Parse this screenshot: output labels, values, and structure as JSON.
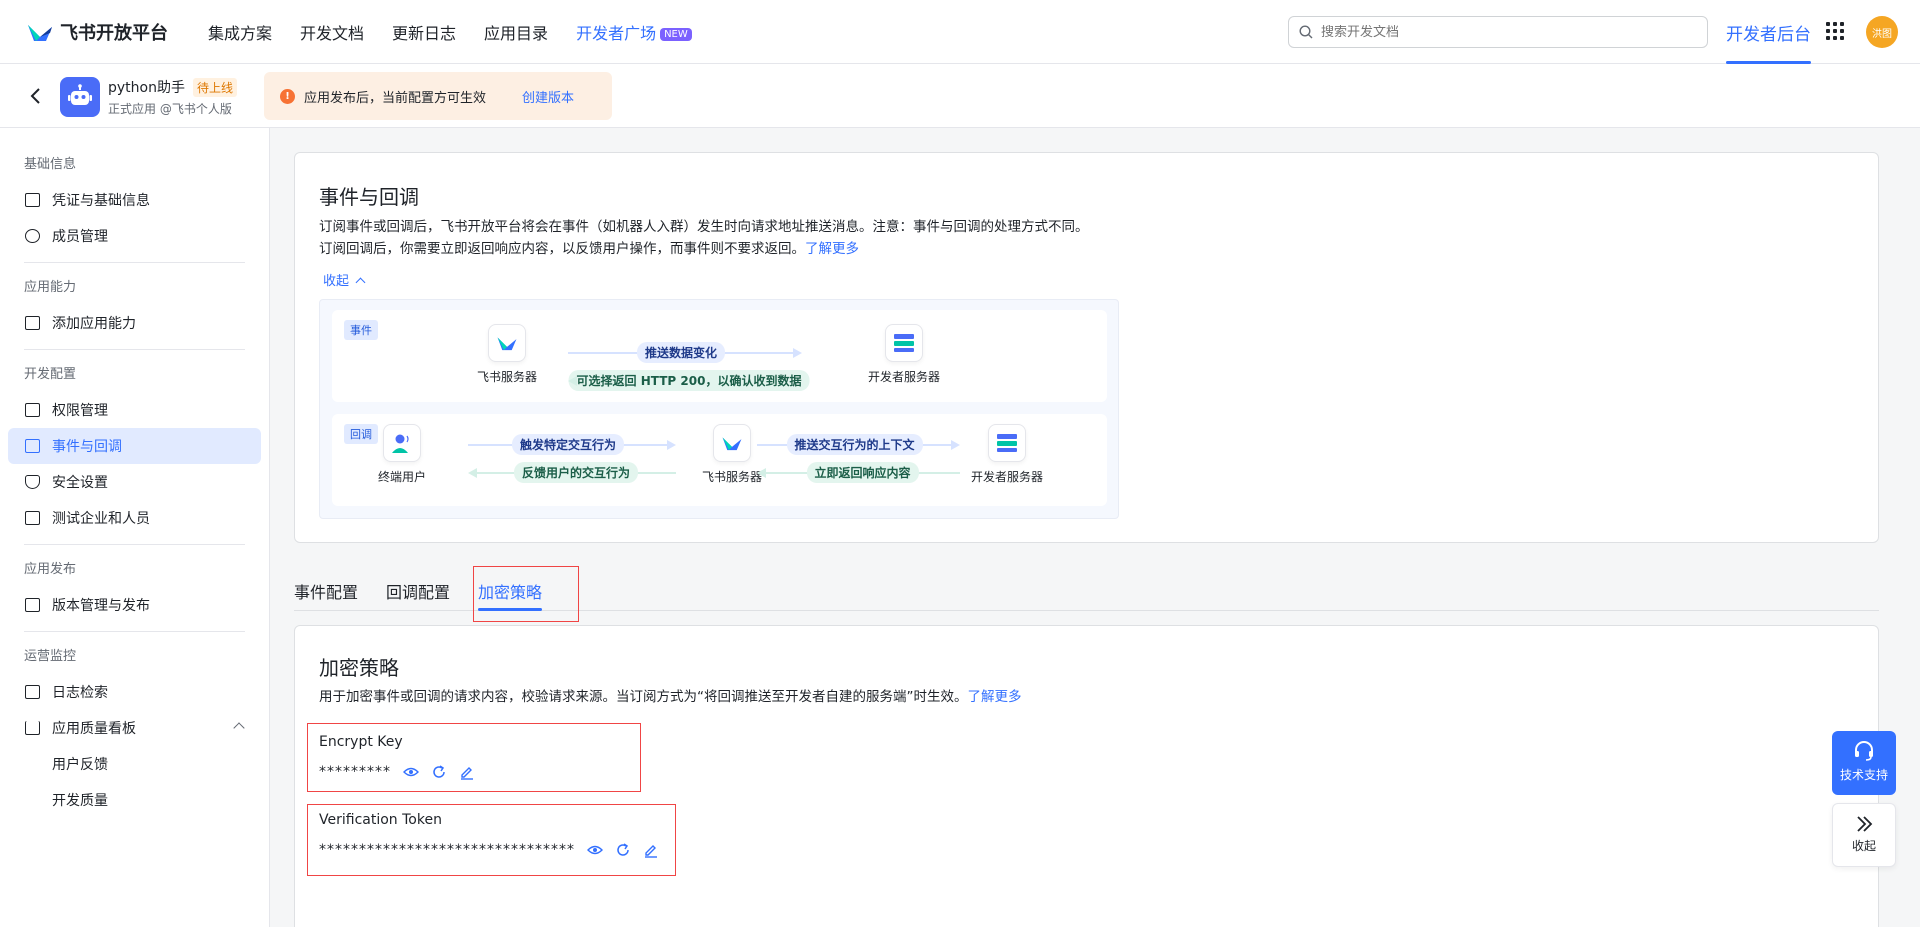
{
  "topnav": {
    "logo": "飞书开放平台",
    "items": [
      "集成方案",
      "开发文档",
      "更新日志",
      "应用目录"
    ],
    "highlight_item": "开发者广场",
    "new_badge": "NEW",
    "search_placeholder": "搜索开发文档",
    "dev_console": "开发者后台",
    "avatar": "洪图"
  },
  "appbar": {
    "app_name": "python助手",
    "status_badge": "待上线",
    "app_sub": "正式应用 @飞书个人版",
    "notice_text": "应用发布后，当前配置方可生效",
    "notice_link": "创建版本"
  },
  "sidebar": {
    "groups": [
      {
        "title": "基础信息",
        "items": [
          "凭证与基础信息",
          "成员管理"
        ]
      },
      {
        "title": "应用能力",
        "items": [
          "添加应用能力"
        ]
      },
      {
        "title": "开发配置",
        "items": [
          "权限管理",
          "事件与回调",
          "安全设置",
          "测试企业和人员"
        ]
      },
      {
        "title": "应用发布",
        "items": [
          "版本管理与发布"
        ]
      },
      {
        "title": "运营监控",
        "items": [
          "日志检索",
          "应用质量看板",
          "用户反馈",
          "开发质量"
        ]
      }
    ],
    "active": "事件与回调"
  },
  "events": {
    "title": "事件与回调",
    "desc_line1": "订阅事件或回调后，飞书开放平台将会在事件（如机器人入群）发生时向请求地址推送消息。注意：事件与回调的处理方式不同。",
    "desc_line2": "订阅回调后，你需要立即返回响应内容，以反馈用户操作，而事件则不要求返回。",
    "learn_more": "了解更多",
    "collapse": "收起",
    "diagram": {
      "event_tag": "事件",
      "callback_tag": "回调",
      "feishu_server": "飞书服务器",
      "dev_server": "开发者服务器",
      "end_user": "终端用户",
      "push_data_change": "推送数据变化",
      "optional_http200": "可选择返回 HTTP 200，以确认收到数据",
      "trigger_interaction": "触发特定交互行为",
      "feedback_interaction": "反馈用户的交互行为",
      "push_context": "推送交互行为的上下文",
      "return_response": "立即返回响应内容"
    }
  },
  "tabs": [
    "事件配置",
    "回调配置",
    "加密策略"
  ],
  "active_tab": "加密策略",
  "encryption": {
    "title": "加密策略",
    "desc": "用于加密事件或回调的请求内容，校验请求来源。当订阅方式为“将回调推送至开发者自建的服务端”时生效。",
    "learn_more": "了解更多",
    "encrypt_key_label": "Encrypt Key",
    "encrypt_key_value": "*********",
    "verification_token_label": "Verification Token",
    "verification_token_value": "********************************"
  },
  "float": {
    "tech_support": "技术支持",
    "collapse": "收起"
  },
  "colors": {
    "primary": "#3370ff",
    "active_bg": "#e1eaff",
    "notice_bg": "#fdefe3",
    "highlight_box": "#f04545"
  }
}
